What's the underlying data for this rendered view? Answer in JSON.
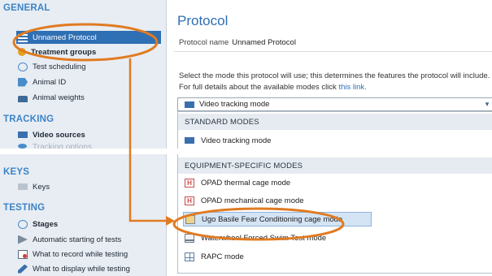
{
  "sidebar": {
    "general": "GENERAL",
    "general_items": [
      {
        "label": "Unnamed Protocol"
      },
      {
        "label": "Treatment groups"
      },
      {
        "label": "Test scheduling"
      },
      {
        "label": "Animal ID"
      },
      {
        "label": "Animal weights"
      }
    ],
    "tracking": "TRACKING",
    "tracking_items": [
      {
        "label": "Video sources"
      },
      {
        "label": "Tracking options"
      }
    ],
    "keys": "KEYS",
    "keys_items": [
      {
        "label": "Keys"
      }
    ],
    "testing": "TESTING",
    "testing_items": [
      {
        "label": "Stages"
      },
      {
        "label": "Automatic starting of tests"
      },
      {
        "label": "What to record while testing"
      },
      {
        "label": "What to display while testing"
      }
    ]
  },
  "main": {
    "title": "Protocol",
    "name_label": "Protocol name",
    "name_value": "Unnamed Protocol",
    "desc_line1": "Select the mode this protocol will use; this determines the features the protocol will include.",
    "desc_line2": "For full details about the available modes click",
    "desc_link": "this link.",
    "selected_mode": "Video tracking mode",
    "dropdown": {
      "standard_header": "STANDARD MODES",
      "standard_options": [
        {
          "label": "Video tracking mode"
        }
      ],
      "equipment_header": "EQUIPMENT-SPECIFIC MODES",
      "equipment_options": [
        {
          "label": "OPAD thermal cage mode"
        },
        {
          "label": "OPAD mechanical cage mode"
        },
        {
          "label": "Ugo Basile Fear Conditioning cage mode"
        },
        {
          "label": "Waterwheel Forced Swim Test mode"
        },
        {
          "label": "RAPC mode"
        }
      ]
    }
  },
  "colors": {
    "accent": "#2f6fb3",
    "section": "#3c84c6",
    "annotation": "#e07b22"
  },
  "icons": {
    "select_chevron": "▾"
  }
}
